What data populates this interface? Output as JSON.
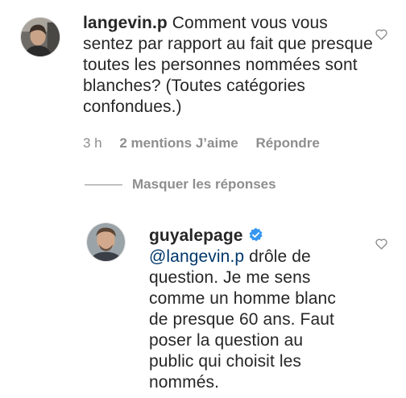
{
  "comment": {
    "username": "langevin.p",
    "text": "Comment vous vous sentez par rapport au fait que presque toutes les personnes nommées sont blanches? (Toutes catégories confondues.)",
    "time": "3 h",
    "likes": "2 mentions J’aime",
    "reply": "Répondre"
  },
  "replies_toggle": {
    "label": "Masquer les réponses"
  },
  "reply": {
    "username": "guyalepage",
    "mention": "@langevin.p",
    "text": "drôle de question. Je me sens comme un homme blanc de presque 60 ans. Faut poser la question au public qui choisit les nommés."
  },
  "icons": {
    "like": "heart-outline-icon",
    "verified": "verified-badge-icon"
  },
  "colors": {
    "meta_gray": "#8e8e8e",
    "link_blue": "#00376b",
    "verified_blue": "#3897f0"
  }
}
